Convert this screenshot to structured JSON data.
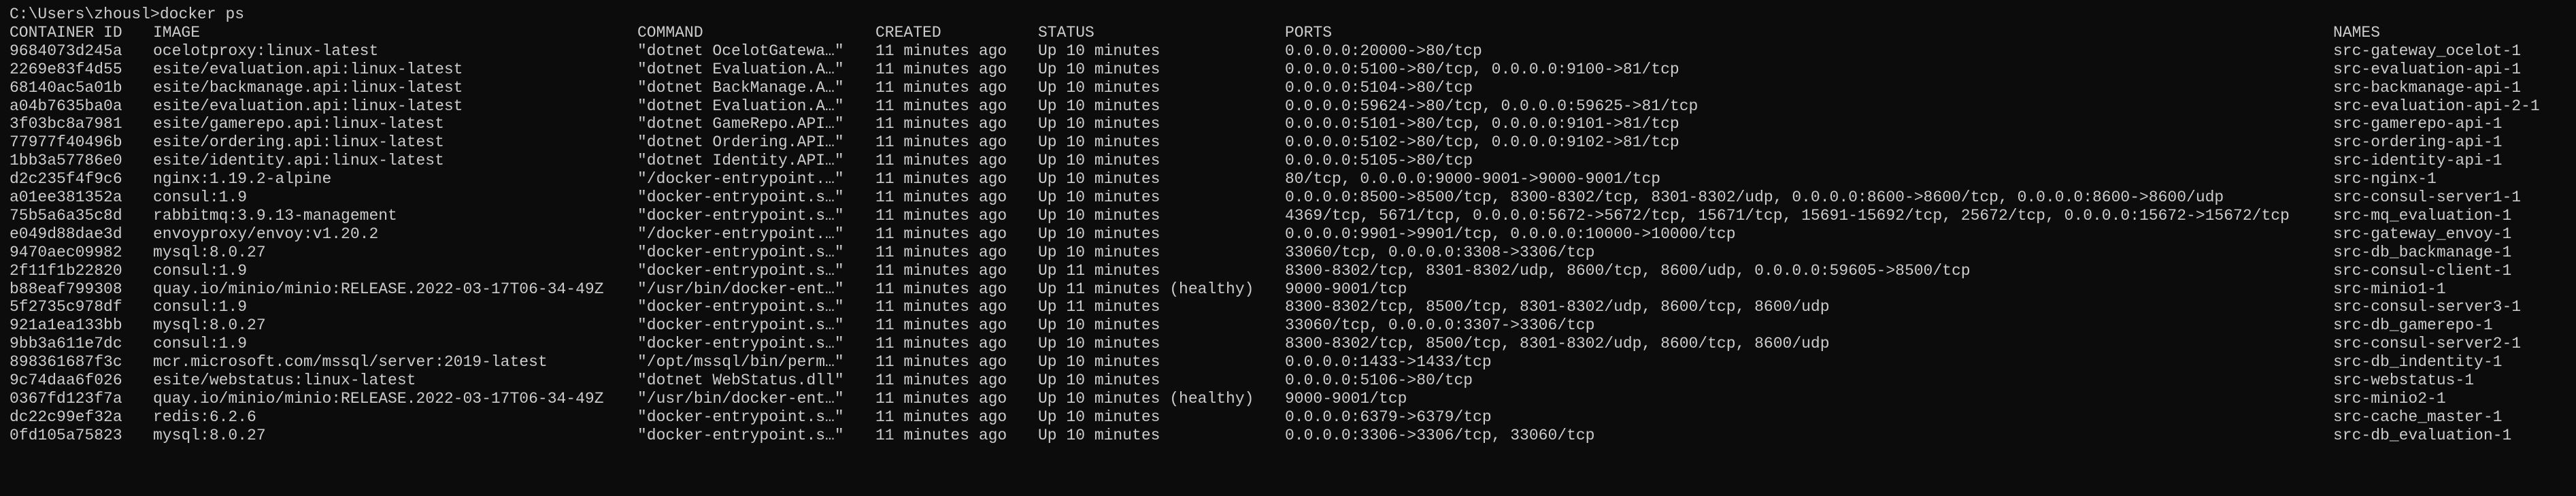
{
  "terminal": {
    "prompt": "C:\\Users\\zhousl>docker ps",
    "foreground": "#cccccc",
    "background": "#0c0c0c"
  },
  "headers": [
    "CONTAINER ID",
    "IMAGE",
    "COMMAND",
    "CREATED",
    "STATUS",
    "PORTS",
    "NAMES"
  ],
  "rows": [
    {
      "id": "9684073d245a",
      "image": "ocelotproxy:linux-latest",
      "command": "\"dotnet OcelotGatewa…\"",
      "created": "11 minutes ago",
      "status": "Up 10 minutes",
      "ports": "0.0.0.0:20000->80/tcp",
      "name": "src-gateway_ocelot-1"
    },
    {
      "id": "2269e83f4d55",
      "image": "esite/evaluation.api:linux-latest",
      "command": "\"dotnet Evaluation.A…\"",
      "created": "11 minutes ago",
      "status": "Up 10 minutes",
      "ports": "0.0.0.0:5100->80/tcp, 0.0.0.0:9100->81/tcp",
      "name": "src-evaluation-api-1"
    },
    {
      "id": "68140ac5a01b",
      "image": "esite/backmanage.api:linux-latest",
      "command": "\"dotnet BackManage.A…\"",
      "created": "11 minutes ago",
      "status": "Up 10 minutes",
      "ports": "0.0.0.0:5104->80/tcp",
      "name": "src-backmanage-api-1"
    },
    {
      "id": "a04b7635ba0a",
      "image": "esite/evaluation.api:linux-latest",
      "command": "\"dotnet Evaluation.A…\"",
      "created": "11 minutes ago",
      "status": "Up 10 minutes",
      "ports": "0.0.0.0:59624->80/tcp, 0.0.0.0:59625->81/tcp",
      "name": "src-evaluation-api-2-1"
    },
    {
      "id": "3f03bc8a7981",
      "image": "esite/gamerepo.api:linux-latest",
      "command": "\"dotnet GameRepo.API…\"",
      "created": "11 minutes ago",
      "status": "Up 10 minutes",
      "ports": "0.0.0.0:5101->80/tcp, 0.0.0.0:9101->81/tcp",
      "name": "src-gamerepo-api-1"
    },
    {
      "id": "77977f40496b",
      "image": "esite/ordering.api:linux-latest",
      "command": "\"dotnet Ordering.API…\"",
      "created": "11 minutes ago",
      "status": "Up 10 minutes",
      "ports": "0.0.0.0:5102->80/tcp, 0.0.0.0:9102->81/tcp",
      "name": "src-ordering-api-1"
    },
    {
      "id": "1bb3a57786e0",
      "image": "esite/identity.api:linux-latest",
      "command": "\"dotnet Identity.API…\"",
      "created": "11 minutes ago",
      "status": "Up 10 minutes",
      "ports": "0.0.0.0:5105->80/tcp",
      "name": "src-identity-api-1"
    },
    {
      "id": "d2c235f4f9c6",
      "image": "nginx:1.19.2-alpine",
      "command": "\"/docker-entrypoint.…\"",
      "created": "11 minutes ago",
      "status": "Up 10 minutes",
      "ports": "80/tcp, 0.0.0.0:9000-9001->9000-9001/tcp",
      "name": "src-nginx-1"
    },
    {
      "id": "a01ee381352a",
      "image": "consul:1.9",
      "command": "\"docker-entrypoint.s…\"",
      "created": "11 minutes ago",
      "status": "Up 10 minutes",
      "ports": "0.0.0.0:8500->8500/tcp, 8300-8302/tcp, 8301-8302/udp, 0.0.0.0:8600->8600/tcp, 0.0.0.0:8600->8600/udp",
      "name": "src-consul-server1-1"
    },
    {
      "id": "75b5a6a35c8d",
      "image": "rabbitmq:3.9.13-management",
      "command": "\"docker-entrypoint.s…\"",
      "created": "11 minutes ago",
      "status": "Up 10 minutes",
      "ports": "4369/tcp, 5671/tcp, 0.0.0.0:5672->5672/tcp, 15671/tcp, 15691-15692/tcp, 25672/tcp, 0.0.0.0:15672->15672/tcp",
      "name": "src-mq_evaluation-1"
    },
    {
      "id": "e049d88dae3d",
      "image": "envoyproxy/envoy:v1.20.2",
      "command": "\"/docker-entrypoint.…\"",
      "created": "11 minutes ago",
      "status": "Up 10 minutes",
      "ports": "0.0.0.0:9901->9901/tcp, 0.0.0.0:10000->10000/tcp",
      "name": "src-gateway_envoy-1"
    },
    {
      "id": "9470aec09982",
      "image": "mysql:8.0.27",
      "command": "\"docker-entrypoint.s…\"",
      "created": "11 minutes ago",
      "status": "Up 10 minutes",
      "ports": "33060/tcp, 0.0.0.0:3308->3306/tcp",
      "name": "src-db_backmanage-1"
    },
    {
      "id": "2f11f1b22820",
      "image": "consul:1.9",
      "command": "\"docker-entrypoint.s…\"",
      "created": "11 minutes ago",
      "status": "Up 11 minutes",
      "ports": "8300-8302/tcp, 8301-8302/udp, 8600/tcp, 8600/udp, 0.0.0.0:59605->8500/tcp",
      "name": "src-consul-client-1"
    },
    {
      "id": "b88eaf799308",
      "image": "quay.io/minio/minio:RELEASE.2022-03-17T06-34-49Z",
      "command": "\"/usr/bin/docker-ent…\"",
      "created": "11 minutes ago",
      "status": "Up 11 minutes (healthy)",
      "ports": "9000-9001/tcp",
      "name": "src-minio1-1"
    },
    {
      "id": "5f2735c978df",
      "image": "consul:1.9",
      "command": "\"docker-entrypoint.s…\"",
      "created": "11 minutes ago",
      "status": "Up 11 minutes",
      "ports": "8300-8302/tcp, 8500/tcp, 8301-8302/udp, 8600/tcp, 8600/udp",
      "name": "src-consul-server3-1"
    },
    {
      "id": "921a1ea133bb",
      "image": "mysql:8.0.27",
      "command": "\"docker-entrypoint.s…\"",
      "created": "11 minutes ago",
      "status": "Up 10 minutes",
      "ports": "33060/tcp, 0.0.0.0:3307->3306/tcp",
      "name": "src-db_gamerepo-1"
    },
    {
      "id": "9bb3a611e7dc",
      "image": "consul:1.9",
      "command": "\"docker-entrypoint.s…\"",
      "created": "11 minutes ago",
      "status": "Up 10 minutes",
      "ports": "8300-8302/tcp, 8500/tcp, 8301-8302/udp, 8600/tcp, 8600/udp",
      "name": "src-consul-server2-1"
    },
    {
      "id": "898361687f3c",
      "image": "mcr.microsoft.com/mssql/server:2019-latest",
      "command": "\"/opt/mssql/bin/perm…\"",
      "created": "11 minutes ago",
      "status": "Up 10 minutes",
      "ports": "0.0.0.0:1433->1433/tcp",
      "name": "src-db_indentity-1"
    },
    {
      "id": "9c74daa6f026",
      "image": "esite/webstatus:linux-latest",
      "command": "\"dotnet WebStatus.dll\"",
      "created": "11 minutes ago",
      "status": "Up 10 minutes",
      "ports": "0.0.0.0:5106->80/tcp",
      "name": "src-webstatus-1"
    },
    {
      "id": "0367fd123f7a",
      "image": "quay.io/minio/minio:RELEASE.2022-03-17T06-34-49Z",
      "command": "\"/usr/bin/docker-ent…\"",
      "created": "11 minutes ago",
      "status": "Up 10 minutes (healthy)",
      "ports": "9000-9001/tcp",
      "name": "src-minio2-1"
    },
    {
      "id": "dc22c99ef32a",
      "image": "redis:6.2.6",
      "command": "\"docker-entrypoint.s…\"",
      "created": "11 minutes ago",
      "status": "Up 10 minutes",
      "ports": "0.0.0.0:6379->6379/tcp",
      "name": "src-cache_master-1"
    },
    {
      "id": "0fd105a75823",
      "image": "mysql:8.0.27",
      "command": "\"docker-entrypoint.s…\"",
      "created": "11 minutes ago",
      "status": "Up 10 minutes",
      "ports": "0.0.0.0:3306->3306/tcp, 33060/tcp",
      "name": "src-db_evaluation-1"
    }
  ]
}
